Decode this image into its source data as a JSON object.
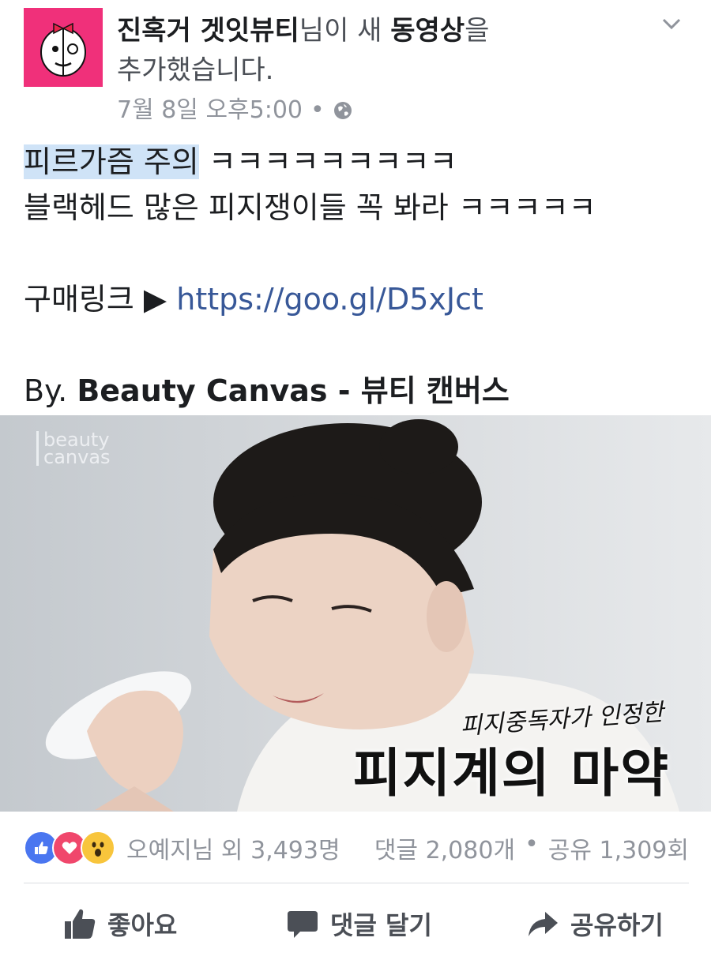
{
  "header": {
    "page_name": "진혹거 겟잇뷰티",
    "text_mid": "님이 새 ",
    "text_bold": "동영상",
    "text_end_1": "을",
    "text_end_2": "추가했습니다.",
    "timestamp": "7월 8일 오후5:00",
    "separator": "•"
  },
  "post": {
    "highlight": "피르가즘 주의",
    "line1_rest": " ㅋㅋㅋㅋㅋㅋㅋㅋㅋ",
    "line2": "블랙헤드 많은 피지쟁이들 꼭 봐라 ㅋㅋㅋㅋㅋ",
    "buy_label": "구매링크 ▶",
    "buy_link": "https://goo.gl/D5xJct",
    "by_prefix": "By. ",
    "by_name": "Beauty Canvas - 뷰티 캔버스"
  },
  "video": {
    "watermark_1": "beauty",
    "watermark_2": "canvas",
    "subtitle_small": "피지중독자가 인정한",
    "subtitle_big": "피지계의 마약"
  },
  "reactions": {
    "names": "오예지님 외 3,493명",
    "comments": "댓글 2,080개",
    "dot": "•",
    "shares": "공유 1,309회"
  },
  "actions": {
    "like": "좋아요",
    "comment": "댓글 달기",
    "share": "공유하기"
  },
  "colors": {
    "avatar_bg": "#f0307a",
    "link": "#385898",
    "highlight": "#cfe3f7",
    "like": "#4a76f0",
    "love": "#f0476c",
    "wow": "#f8c53c"
  }
}
